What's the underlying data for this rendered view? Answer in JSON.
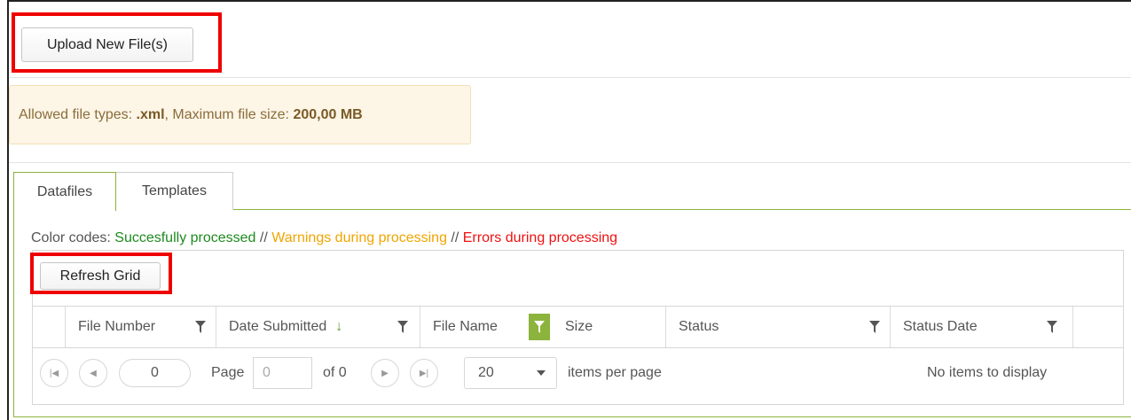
{
  "upload": {
    "label": "Upload New File(s)"
  },
  "notice": {
    "prefix": "Allowed file types: ",
    "types": ".xml",
    "middle": ", Maximum file size: ",
    "size": "200,00 MB"
  },
  "tabs": [
    {
      "label": "Datafiles",
      "active": true
    },
    {
      "label": "Templates",
      "active": false
    }
  ],
  "color_codes": {
    "prefix": "Color codes: ",
    "success": "Succesfully processed",
    "sep": " // ",
    "warning": "Warnings during processing",
    "error": "Errors during processing",
    "colors": {
      "success": "#1e8a1e",
      "warning": "#f0a500",
      "error": "#ee1111"
    }
  },
  "grid": {
    "refresh_label": "Refresh Grid",
    "columns": [
      {
        "label": "File Number",
        "filter": true
      },
      {
        "label": "Date Submitted",
        "filter": true,
        "sort": "↓"
      },
      {
        "label": "File Name",
        "filter": true,
        "filter_active": true
      },
      {
        "label": "Size",
        "filter": false
      },
      {
        "label": "Status",
        "filter": true
      },
      {
        "label": "Status Date",
        "filter": true
      }
    ]
  },
  "pager": {
    "current": "0",
    "page_label": "Page",
    "page_value": "0",
    "of_label": "of 0",
    "per_page_value": "20",
    "per_page_label": "items per page",
    "status": "No items to display",
    "icons": [
      "first-page-icon",
      "prev-page-icon",
      "next-page-icon",
      "last-page-icon"
    ]
  },
  "accent": "#8cb33c"
}
